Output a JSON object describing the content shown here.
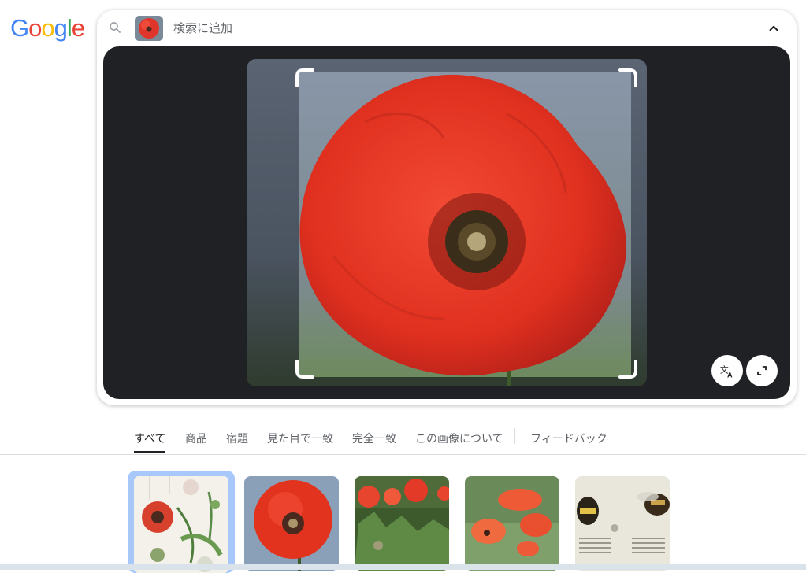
{
  "logo": {
    "text": "Google"
  },
  "search": {
    "placeholder": "検索に追加",
    "icon": "search-icon",
    "collapse_icon": "chevron-up-icon"
  },
  "viewer": {
    "translate_icon": "translate-icon",
    "fullscreen_icon": "fullscreen-icon"
  },
  "tabs": [
    {
      "label": "すべて",
      "active": true
    },
    {
      "label": "商品"
    },
    {
      "label": "宿題"
    },
    {
      "label": "見た目で一致"
    },
    {
      "label": "完全一致"
    },
    {
      "label": "この画像について"
    },
    {
      "label": "フィードバック"
    }
  ],
  "colors": {
    "accent_selected": "#a8c7fa",
    "viewer_bg": "#202124",
    "poppy_red": "#e8382a"
  }
}
